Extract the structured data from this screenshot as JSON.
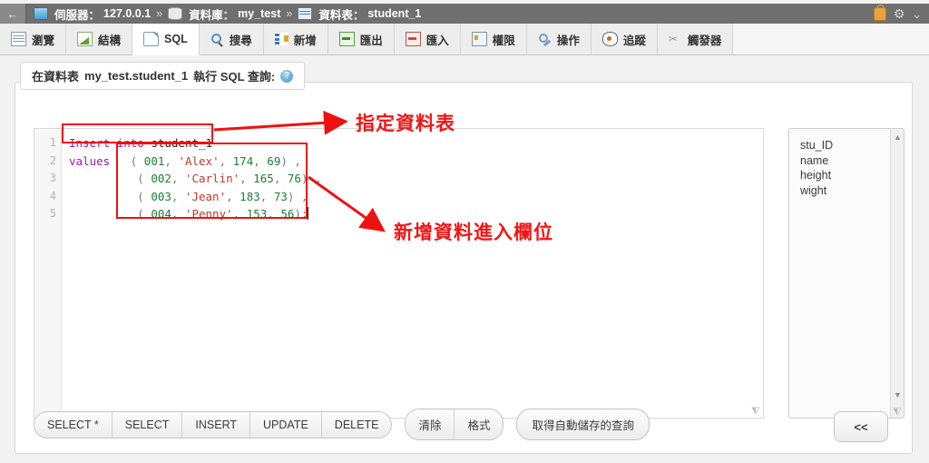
{
  "window": {
    "back_arrow": "←",
    "breadcrumb": {
      "server_label": "伺服器：",
      "server_value": "127.0.0.1",
      "database_label": "資料庫：",
      "database_value": "my_test",
      "table_label": "資料表：",
      "table_value": "student_1",
      "separator": "»"
    },
    "right_icons": {
      "lock": "lock-icon",
      "gear": "⚙",
      "collapse": "⌄"
    }
  },
  "tabs": [
    {
      "label": "瀏覽",
      "icon": "browse-icon",
      "active": false
    },
    {
      "label": "結構",
      "icon": "structure-icon",
      "active": false
    },
    {
      "label": "SQL",
      "icon": "sql-icon",
      "active": true
    },
    {
      "label": "搜尋",
      "icon": "search-icon",
      "active": false
    },
    {
      "label": "新增",
      "icon": "insert-icon",
      "active": false
    },
    {
      "label": "匯出",
      "icon": "export-icon",
      "active": false
    },
    {
      "label": "匯入",
      "icon": "import-icon",
      "active": false
    },
    {
      "label": "權限",
      "icon": "privileges-icon",
      "active": false
    },
    {
      "label": "操作",
      "icon": "operations-icon",
      "active": false
    },
    {
      "label": "追蹤",
      "icon": "tracking-icon",
      "active": false
    },
    {
      "label": "觸發器",
      "icon": "triggers-icon",
      "active": false
    }
  ],
  "panel": {
    "legend_prefix": "在資料表",
    "legend_target": "my_test.student_1",
    "legend_suffix": "執行 SQL 查詢:",
    "help_icon": "?"
  },
  "editor": {
    "line_numbers": [
      "1",
      "2",
      "3",
      "4",
      "5"
    ],
    "lines": [
      {
        "n": "1",
        "tokens": [
          {
            "t": "Insert into ",
            "c": "kw"
          },
          {
            "t": "student_1",
            "c": "ident"
          }
        ]
      },
      {
        "n": "2",
        "tokens": [
          {
            "t": "values ",
            "c": "kw"
          },
          {
            "t": "  ( ",
            "c": "punc"
          },
          {
            "t": "001",
            "c": "num"
          },
          {
            "t": ", ",
            "c": "punc"
          },
          {
            "t": "'Alex'",
            "c": "str"
          },
          {
            "t": ", ",
            "c": "punc"
          },
          {
            "t": "174",
            "c": "num"
          },
          {
            "t": ", ",
            "c": "punc"
          },
          {
            "t": "69",
            "c": "num"
          },
          {
            "t": ") ,",
            "c": "punc"
          }
        ]
      },
      {
        "n": "3",
        "tokens": [
          {
            "t": "          ( ",
            "c": "punc"
          },
          {
            "t": "002",
            "c": "num"
          },
          {
            "t": ", ",
            "c": "punc"
          },
          {
            "t": "'Carlin'",
            "c": "str"
          },
          {
            "t": ", ",
            "c": "punc"
          },
          {
            "t": "165",
            "c": "num"
          },
          {
            "t": ", ",
            "c": "punc"
          },
          {
            "t": "76",
            "c": "num"
          },
          {
            "t": ") ,",
            "c": "punc"
          }
        ]
      },
      {
        "n": "4",
        "tokens": [
          {
            "t": "          ( ",
            "c": "punc"
          },
          {
            "t": "003",
            "c": "num"
          },
          {
            "t": ", ",
            "c": "punc"
          },
          {
            "t": "'Jean'",
            "c": "str"
          },
          {
            "t": ", ",
            "c": "punc"
          },
          {
            "t": "183",
            "c": "num"
          },
          {
            "t": ", ",
            "c": "punc"
          },
          {
            "t": "73",
            "c": "num"
          },
          {
            "t": ") ,",
            "c": "punc"
          }
        ]
      },
      {
        "n": "5",
        "tokens": [
          {
            "t": "          ( ",
            "c": "punc"
          },
          {
            "t": "004",
            "c": "num"
          },
          {
            "t": ", ",
            "c": "punc"
          },
          {
            "t": "'Penny'",
            "c": "str"
          },
          {
            "t": ", ",
            "c": "punc"
          },
          {
            "t": "153",
            "c": "num"
          },
          {
            "t": ", ",
            "c": "punc"
          },
          {
            "t": "56",
            "c": "num"
          },
          {
            "t": ");",
            "c": "punc"
          }
        ]
      }
    ],
    "resize_grip": "⧨",
    "syntax_colors": {
      "keyword": "#9b1fa0",
      "identifier": "#222222",
      "number": "#1a7f37",
      "string": "#c2392c",
      "punctuation": "#7a7a7a"
    }
  },
  "column_list": {
    "items": [
      "stu_ID",
      "name",
      "height",
      "wight"
    ],
    "scroll_up": "▲",
    "scroll_down": "▼",
    "resize_grip": "⧨"
  },
  "buttons": {
    "group": [
      "SELECT *",
      "SELECT",
      "INSERT",
      "UPDATE",
      "DELETE"
    ],
    "group2": [
      "清除",
      "格式"
    ],
    "autosave": "取得自動儲存的查詢",
    "collapse": "<<"
  },
  "annotations": [
    {
      "text": "指定資料表",
      "color": "#f31414"
    },
    {
      "text": "新增資料進入欄位",
      "color": "#f31414"
    }
  ]
}
